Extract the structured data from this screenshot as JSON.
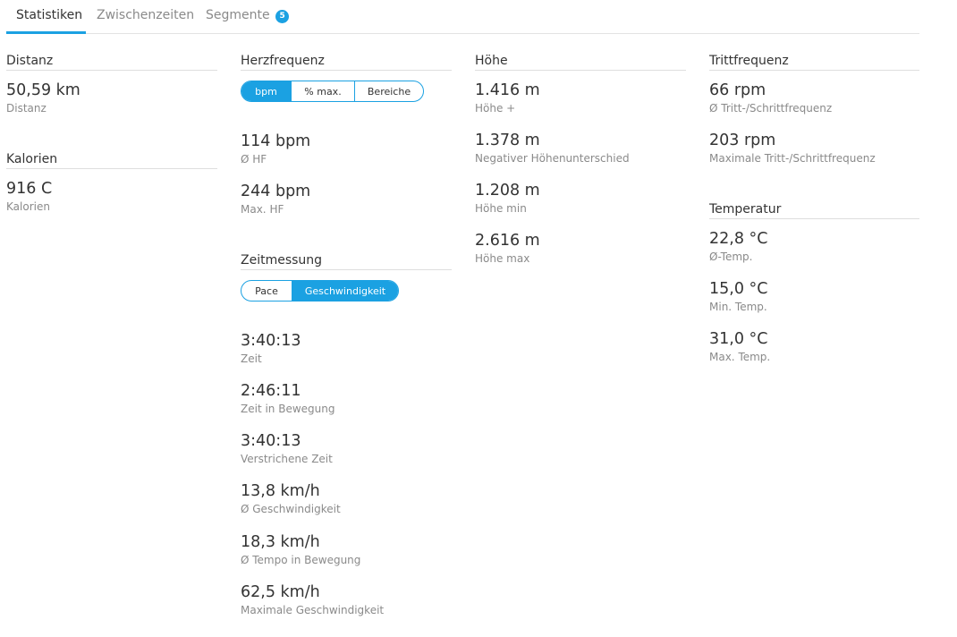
{
  "tabs": [
    {
      "label": "Statistiken"
    },
    {
      "label": "Zwischenzeiten"
    },
    {
      "label": "Segmente",
      "badge": "5"
    }
  ],
  "accent_color": "#1ba1e2",
  "distanz": {
    "title": "Distanz",
    "stats": [
      {
        "value": "50,59 km",
        "label": "Distanz"
      }
    ]
  },
  "kalorien": {
    "title": "Kalorien",
    "stats": [
      {
        "value": "916 C",
        "label": "Kalorien"
      }
    ]
  },
  "herzfrequenz": {
    "title": "Herzfrequenz",
    "toggle": [
      "bpm",
      "% max.",
      "Bereiche"
    ],
    "selected": "bpm",
    "stats": [
      {
        "value": "114 bpm",
        "label": "Ø HF"
      },
      {
        "value": "244 bpm",
        "label": "Max. HF"
      }
    ]
  },
  "zeitmessung": {
    "title": "Zeitmessung",
    "toggle": [
      "Pace",
      "Geschwindigkeit"
    ],
    "selected": "Geschwindigkeit",
    "stats": [
      {
        "value": "3:40:13",
        "label": "Zeit"
      },
      {
        "value": "2:46:11",
        "label": "Zeit in Bewegung"
      },
      {
        "value": "3:40:13",
        "label": "Verstrichene Zeit"
      },
      {
        "value": "13,8 km/h",
        "label": "Ø Geschwindigkeit"
      },
      {
        "value": "18,3 km/h",
        "label": "Ø Tempo in Bewegung"
      },
      {
        "value": "62,5 km/h",
        "label": "Maximale Geschwindigkeit"
      }
    ]
  },
  "hoehe": {
    "title": "Höhe",
    "stats": [
      {
        "value": "1.416 m",
        "label": "Höhe +"
      },
      {
        "value": "1.378 m",
        "label": "Negativer Höhenunterschied"
      },
      {
        "value": "1.208 m",
        "label": "Höhe min"
      },
      {
        "value": "2.616 m",
        "label": "Höhe max"
      }
    ]
  },
  "trittfrequenz": {
    "title": "Trittfrequenz",
    "stats": [
      {
        "value": "66 rpm",
        "label": "Ø Tritt-/Schrittfrequenz"
      },
      {
        "value": "203 rpm",
        "label": "Maximale Tritt-/Schrittfrequenz"
      }
    ]
  },
  "temperatur": {
    "title": "Temperatur",
    "stats": [
      {
        "value": "22,8 °C",
        "label": "Ø-Temp."
      },
      {
        "value": "15,0 °C",
        "label": "Min. Temp."
      },
      {
        "value": "31,0 °C",
        "label": "Max. Temp."
      }
    ]
  }
}
